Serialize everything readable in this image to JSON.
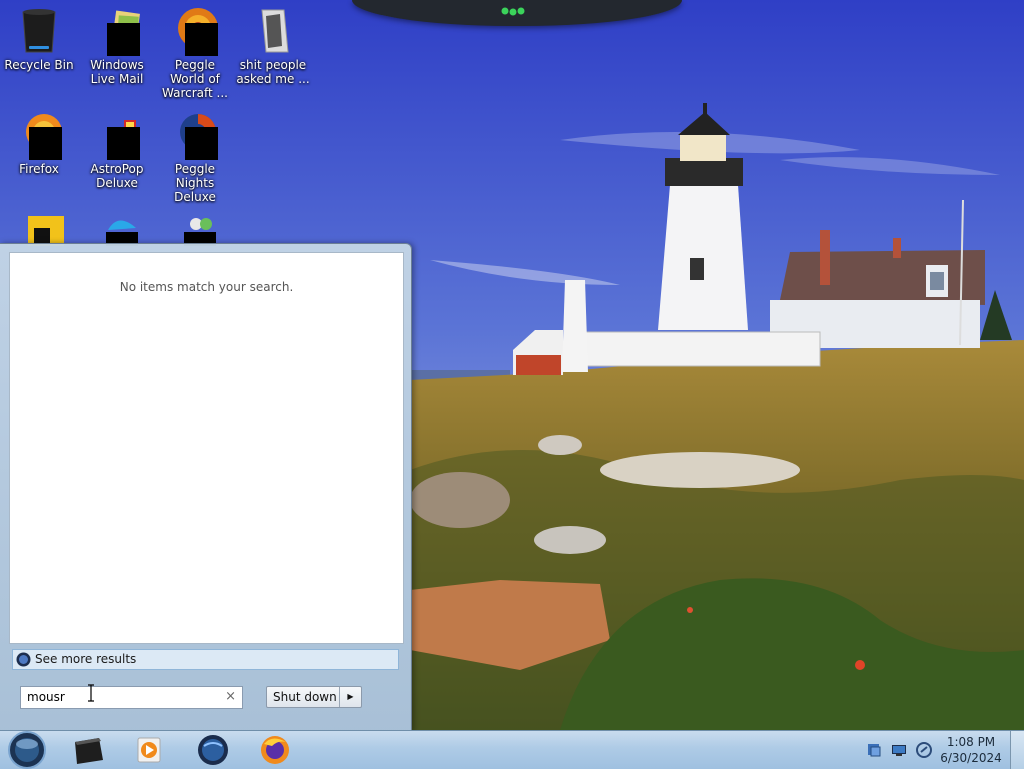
{
  "desktop": {
    "icons": [
      {
        "label": "Recycle Bin",
        "icon": "recycle-bin-icon"
      },
      {
        "label": "Windows Live Mail",
        "icon": "windows-live-mail-icon"
      },
      {
        "label": "Peggle World of Warcraft ...",
        "icon": "peggle-wow-icon"
      },
      {
        "label": "shit people asked me ...",
        "icon": "folder-icon"
      },
      {
        "label": "Firefox",
        "icon": "firefox-icon"
      },
      {
        "label": "AstroPop Deluxe",
        "icon": "astropop-icon"
      },
      {
        "label": "Peggle Nights Deluxe",
        "icon": "peggle-nights-icon"
      }
    ]
  },
  "start_menu": {
    "no_results_text": "No items match your search.",
    "see_more_label": "See more results",
    "search_value": "mousr",
    "search_clear": "×",
    "shutdown_label": "Shut down",
    "shutdown_arrow": "▶"
  },
  "taskbar": {
    "apps": [
      "dark-box-app-icon",
      "media-player-icon",
      "globe-app-icon",
      "firefox-icon"
    ],
    "tray": [
      "action-center-icon",
      "network-icon",
      "volume-icon"
    ],
    "clock_time": "1:08 PM",
    "clock_date": "6/30/2024"
  }
}
